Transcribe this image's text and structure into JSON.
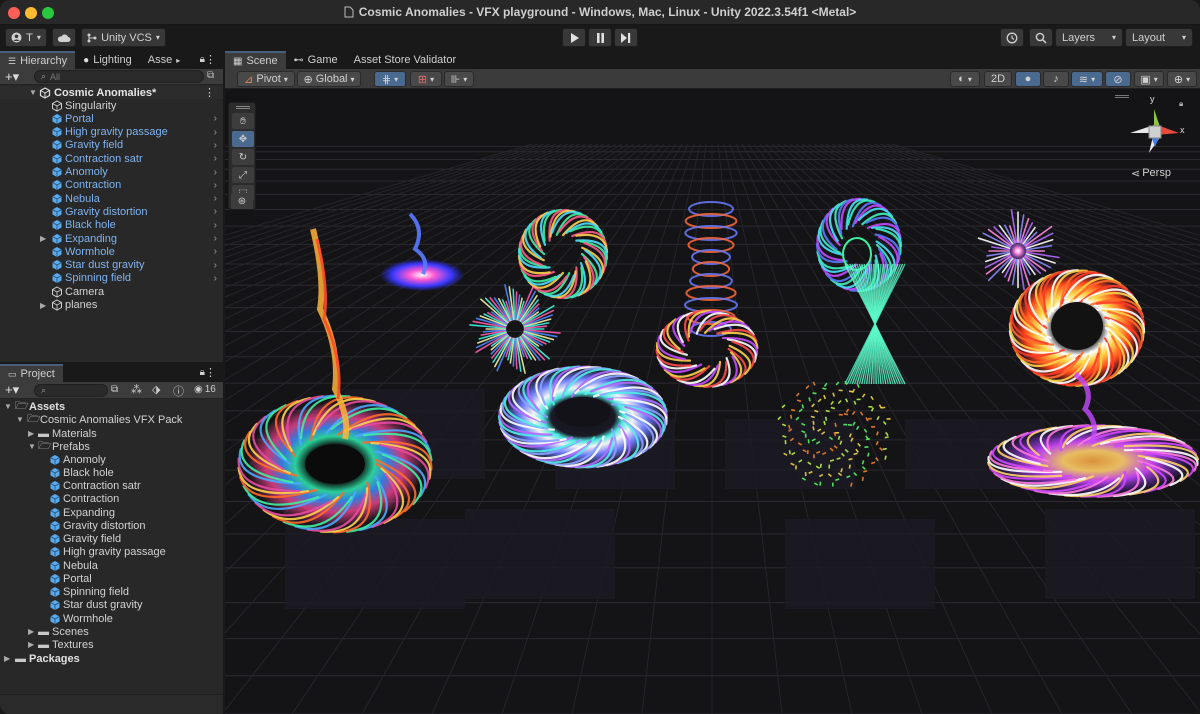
{
  "window": {
    "title": "Cosmic Anomalies - VFX playground - Windows, Mac, Linux - Unity 2022.3.54f1 <Metal>"
  },
  "toolbar": {
    "account_label": "T",
    "vcs_label": "Unity VCS",
    "layers_label": "Layers",
    "layout_label": "Layout"
  },
  "hierarchy": {
    "tabs": [
      "Hierarchy",
      "Lighting",
      "Asse"
    ],
    "search_placeholder": "All",
    "scene_name": "Cosmic Anomalies*",
    "items": [
      {
        "label": "Singularity",
        "prefab": false
      },
      {
        "label": "Portal",
        "prefab": true
      },
      {
        "label": "High gravity passage",
        "prefab": true
      },
      {
        "label": "Gravity field",
        "prefab": true
      },
      {
        "label": "Contraction satr",
        "prefab": true
      },
      {
        "label": "Anomoly",
        "prefab": true
      },
      {
        "label": "Contraction",
        "prefab": true
      },
      {
        "label": "Nebula",
        "prefab": true
      },
      {
        "label": "Gravity distortion",
        "prefab": true
      },
      {
        "label": "Black hole",
        "prefab": true
      },
      {
        "label": "Expanding",
        "prefab": true
      },
      {
        "label": "Wormhole",
        "prefab": true
      },
      {
        "label": "Star dust gravity",
        "prefab": true
      },
      {
        "label": "Spinning field",
        "prefab": true
      },
      {
        "label": "Camera",
        "prefab": false
      },
      {
        "label": "planes",
        "prefab": false
      }
    ]
  },
  "project": {
    "tab": "Project",
    "hidden_count": "16",
    "tree": {
      "assets": "Assets",
      "pack": "Cosmic Anomalies VFX Pack",
      "materials": "Materials",
      "prefabs": "Prefabs",
      "prefab_items": [
        "Anomoly",
        "Black hole",
        "Contraction satr",
        "Contraction",
        "Expanding",
        "Gravity distortion",
        "Gravity field",
        "High gravity passage",
        "Nebula",
        "Portal",
        "Spinning field",
        "Star dust gravity",
        "Wormhole"
      ],
      "scenes": "Scenes",
      "textures": "Textures",
      "packages": "Packages"
    }
  },
  "scene_view": {
    "tabs": [
      "Scene",
      "Game",
      "Asset Store Validator"
    ],
    "pivot_label": "Pivot",
    "global_label": "Global",
    "mode_2d": "2D",
    "gizmo": {
      "y": "y",
      "x": "x",
      "projection": "Persp"
    }
  },
  "colors": {
    "accent_blue": "#4b6a8f",
    "prefab_text": "#7eb3f2",
    "prefab_icon": "#5aa9ea"
  }
}
